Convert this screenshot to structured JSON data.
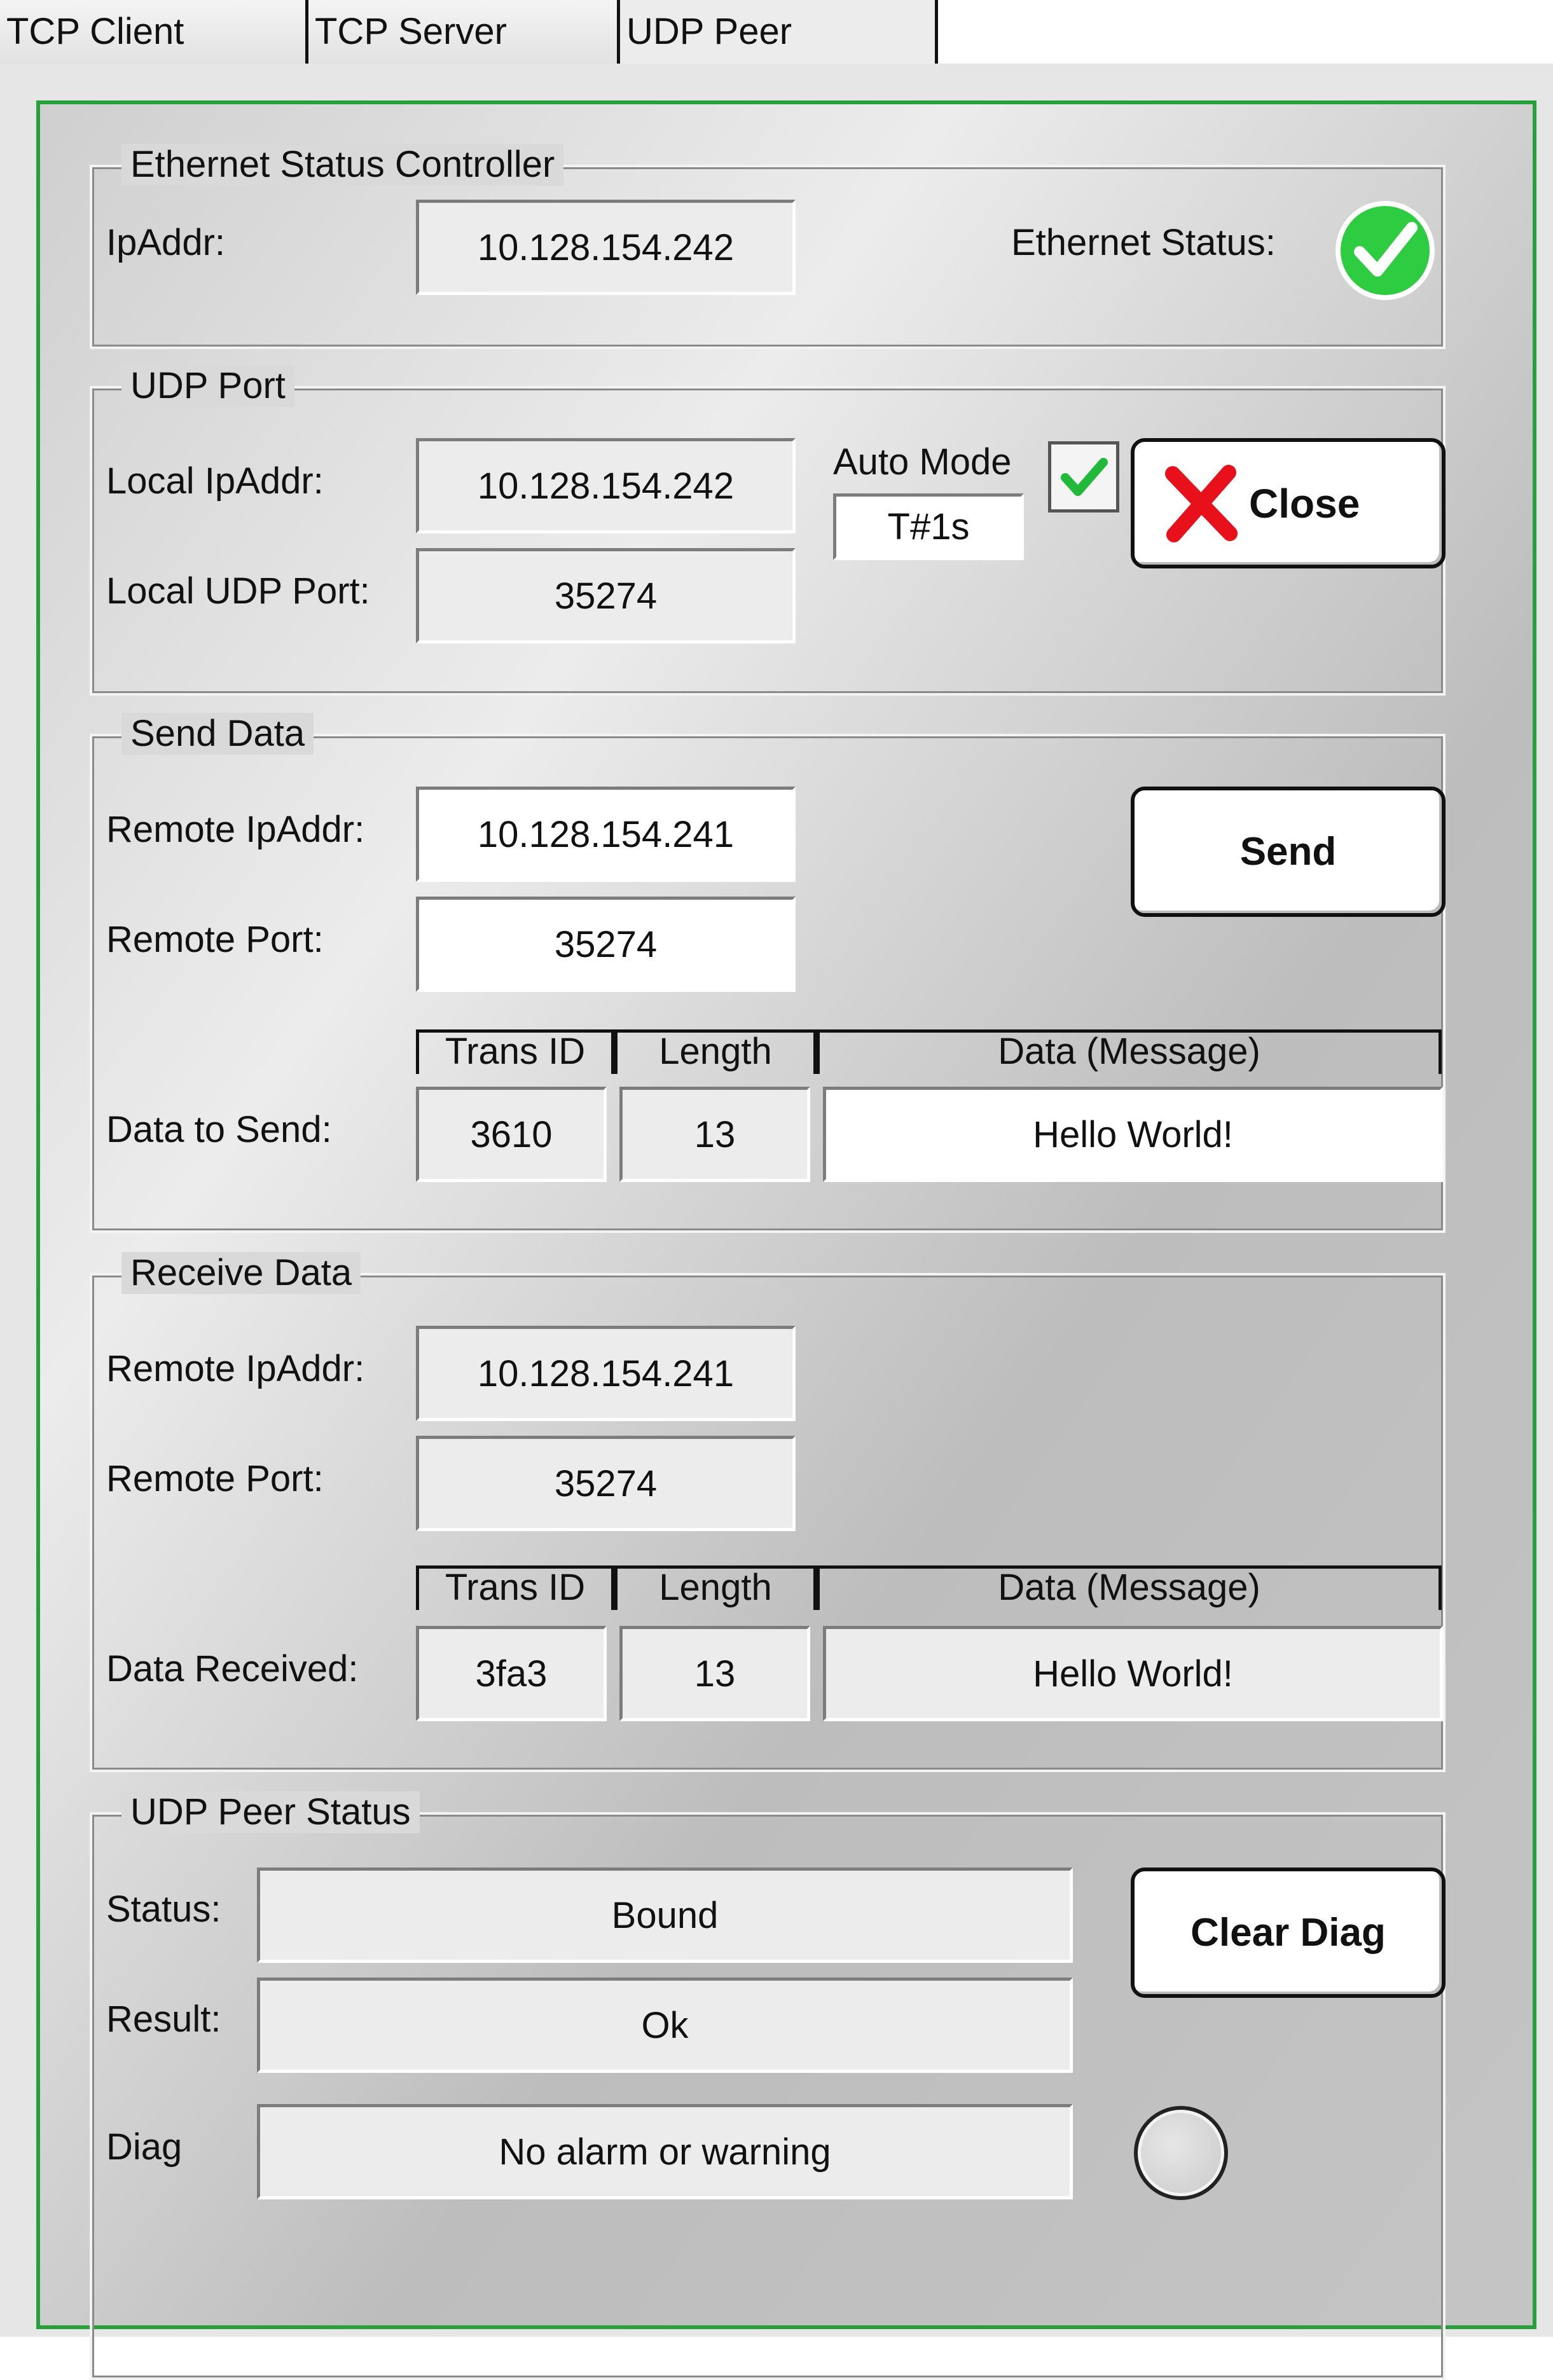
{
  "tabs": [
    "TCP Client",
    "TCP Server",
    "UDP Peer"
  ],
  "ethernet": {
    "legend": "Ethernet Status Controller",
    "ip_label": "IpAddr:",
    "ip_value": "10.128.154.242",
    "status_label": "Ethernet Status:",
    "status_icon": "green-check-circle-icon"
  },
  "udp_port": {
    "legend": "UDP Port",
    "local_ip_label": "Local IpAddr:",
    "local_ip_value": "10.128.154.242",
    "local_port_label": "Local UDP Port:",
    "local_port_value": "35274",
    "auto_mode_label": "Auto Mode",
    "auto_mode_value": "T#1s",
    "auto_mode_checked": true,
    "close_label": "Close",
    "close_icon": "red-x-icon"
  },
  "send": {
    "legend": "Send Data",
    "remote_ip_label": "Remote IpAddr:",
    "remote_ip_value": "10.128.154.241",
    "remote_port_label": "Remote Port:",
    "remote_port_value": "35274",
    "send_label": "Send",
    "columns": [
      "Trans ID",
      "Length",
      "Data (Message)"
    ],
    "data_label": "Data to Send:",
    "trans_id": "3610",
    "length": "13",
    "message": "Hello World!"
  },
  "receive": {
    "legend": "Receive Data",
    "remote_ip_label": "Remote IpAddr:",
    "remote_ip_value": "10.128.154.241",
    "remote_port_label": "Remote Port:",
    "remote_port_value": "35274",
    "columns": [
      "Trans ID",
      "Length",
      "Data (Message)"
    ],
    "data_label": "Data Received:",
    "trans_id": "3fa3",
    "length": "13",
    "message": "Hello World!"
  },
  "peer_status": {
    "legend": "UDP Peer Status",
    "status_label": "Status:",
    "status_value": "Bound",
    "result_label": "Result:",
    "result_value": "Ok",
    "diag_label": "Diag",
    "diag_value": "No alarm or warning",
    "clear_label": "Clear Diag",
    "diag_indicator": "off"
  },
  "colors": {
    "panel_border": "#27a03c",
    "ok_green": "#2ecc40",
    "close_red": "#e8101a"
  }
}
